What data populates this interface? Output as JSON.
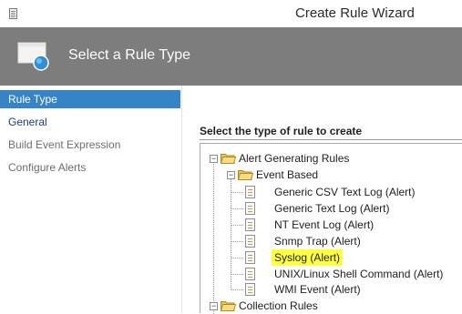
{
  "window": {
    "title": "Create Rule Wizard"
  },
  "header": {
    "title": "Select a Rule Type"
  },
  "nav": {
    "items": [
      {
        "label": "Rule Type",
        "state": "active"
      },
      {
        "label": "General",
        "state": "enabled"
      },
      {
        "label": "Build Event Expression",
        "state": "disabled"
      },
      {
        "label": "Configure Alerts",
        "state": "disabled"
      }
    ]
  },
  "main": {
    "heading": "Select the type of rule to create",
    "tree": {
      "root1": "Alert Generating Rules",
      "group1": "Event Based",
      "leaves": [
        "Generic CSV Text Log (Alert)",
        "Generic Text Log (Alert)",
        "NT Event Log (Alert)",
        "Snmp Trap (Alert)",
        "Syslog (Alert)",
        "UNIX/Linux Shell Command (Alert)",
        "WMI Event (Alert)"
      ],
      "highlighted": "Syslog (Alert)",
      "root2": "Collection Rules"
    }
  },
  "colors": {
    "header_bg": "#7d7d7d",
    "nav_active_bg": "#3584c7",
    "highlight": "#ffff40"
  },
  "icons": {
    "app": "document-icon",
    "wizard": "wizard-window-icon",
    "folder": "folder-icon",
    "rule": "rule-document-icon"
  }
}
